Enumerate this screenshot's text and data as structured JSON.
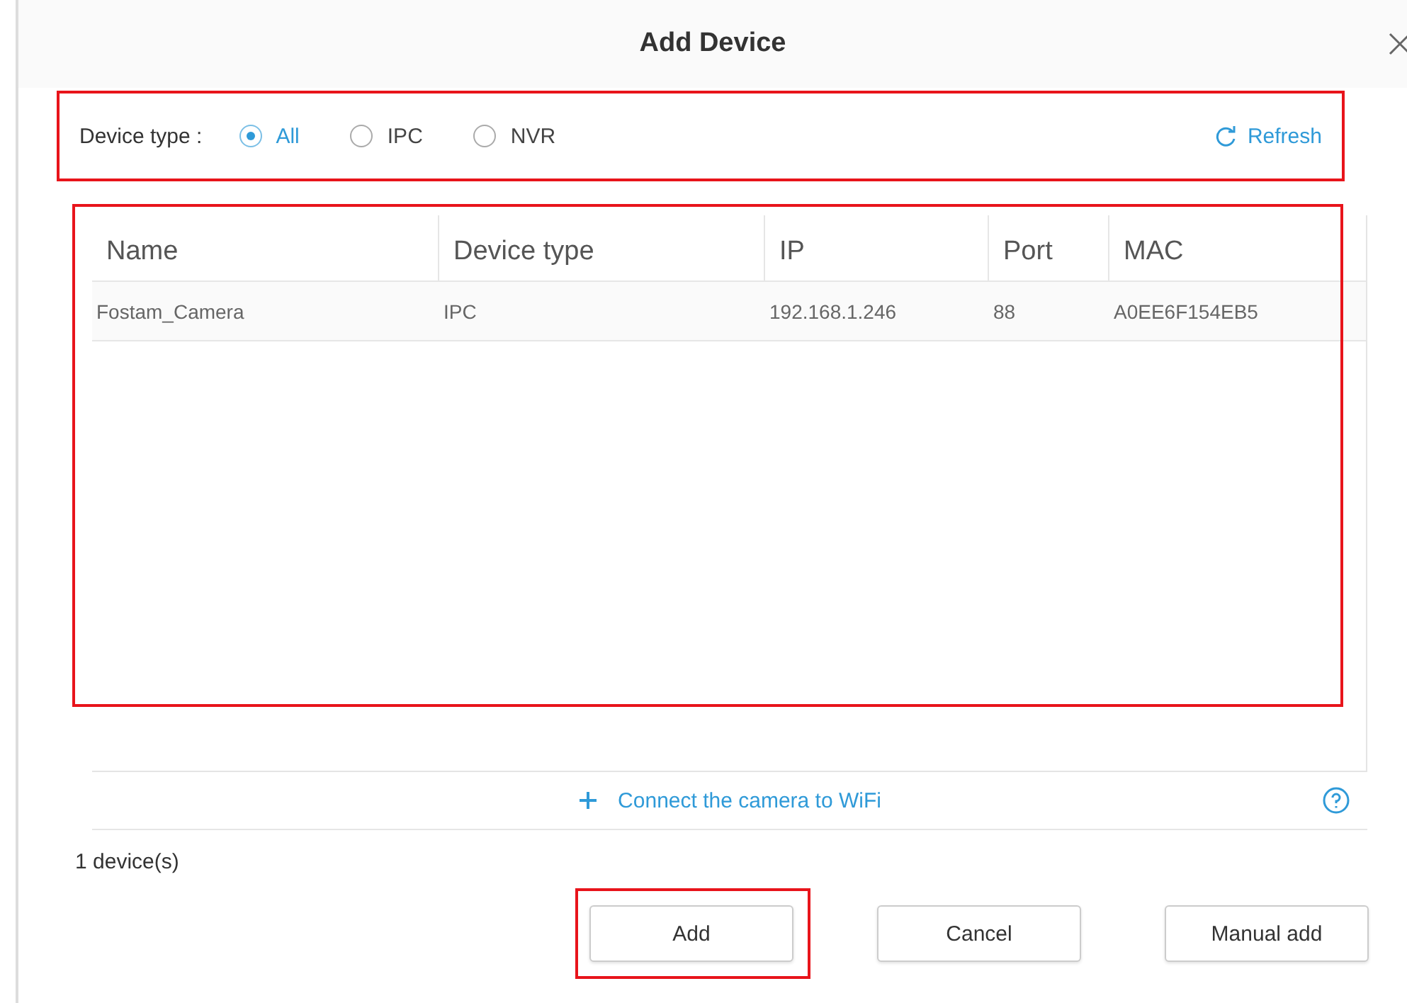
{
  "window": {
    "title": "Add Device"
  },
  "filter": {
    "label": "Device type :",
    "highlighted": true,
    "options": [
      {
        "label": "All",
        "selected": true
      },
      {
        "label": "IPC",
        "selected": false
      },
      {
        "label": "NVR",
        "selected": false
      }
    ],
    "refresh": "Refresh"
  },
  "table": {
    "highlighted": true,
    "columns": [
      "Name",
      "Device type",
      "IP",
      "Port",
      "MAC"
    ],
    "rows": [
      [
        "Fostam_Camera",
        "IPC",
        "192.168.1.246",
        "88",
        "A0EE6F154EB5"
      ]
    ]
  },
  "connect_wifi": "Connect the camera to WiFi",
  "count": "1 device(s)",
  "buttons": [
    {
      "label": "Add",
      "highlighted": true
    },
    {
      "label": "Cancel",
      "highlighted": false
    },
    {
      "label": "Manual add",
      "highlighted": false
    }
  ]
}
